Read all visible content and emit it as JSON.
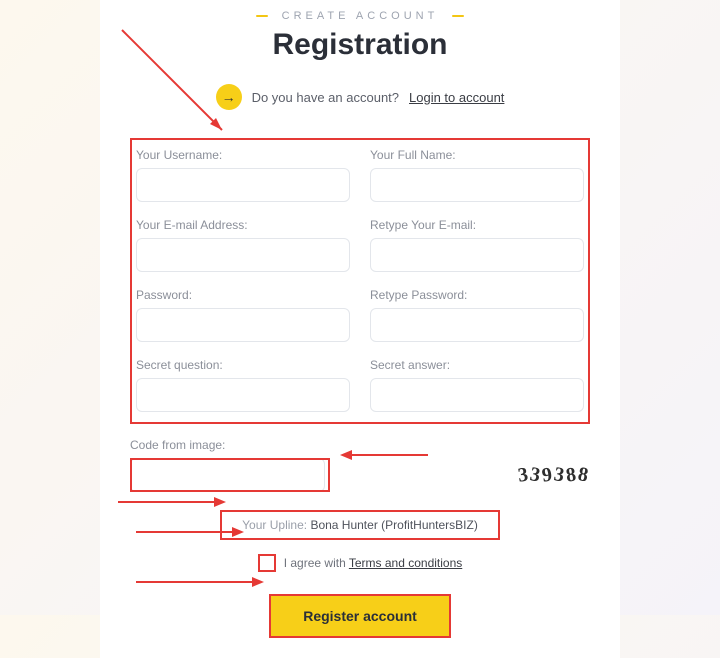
{
  "eyebrow": "CREATE ACCOUNT",
  "title": "Registration",
  "login": {
    "prompt": "Do you have an account?",
    "link": "Login to account"
  },
  "fields": {
    "username": {
      "label": "Your Username:"
    },
    "fullname": {
      "label": "Your Full Name:"
    },
    "email": {
      "label": "Your E-mail Address:"
    },
    "email2": {
      "label": "Retype Your E-mail:"
    },
    "password": {
      "label": "Password:"
    },
    "password2": {
      "label": "Retype Password:"
    },
    "secret_q": {
      "label": "Secret question:"
    },
    "secret_a": {
      "label": "Secret answer:"
    }
  },
  "captcha": {
    "label": "Code from image:",
    "code": "339388"
  },
  "upline": {
    "label": "Your Upline: ",
    "value": "Bona Hunter (ProfitHuntersBIZ)"
  },
  "terms": {
    "text": "I agree with ",
    "link": "Terms and conditions"
  },
  "submit": "Register account",
  "colors": {
    "accent": "#f7cf18",
    "annotation": "#e53935"
  }
}
